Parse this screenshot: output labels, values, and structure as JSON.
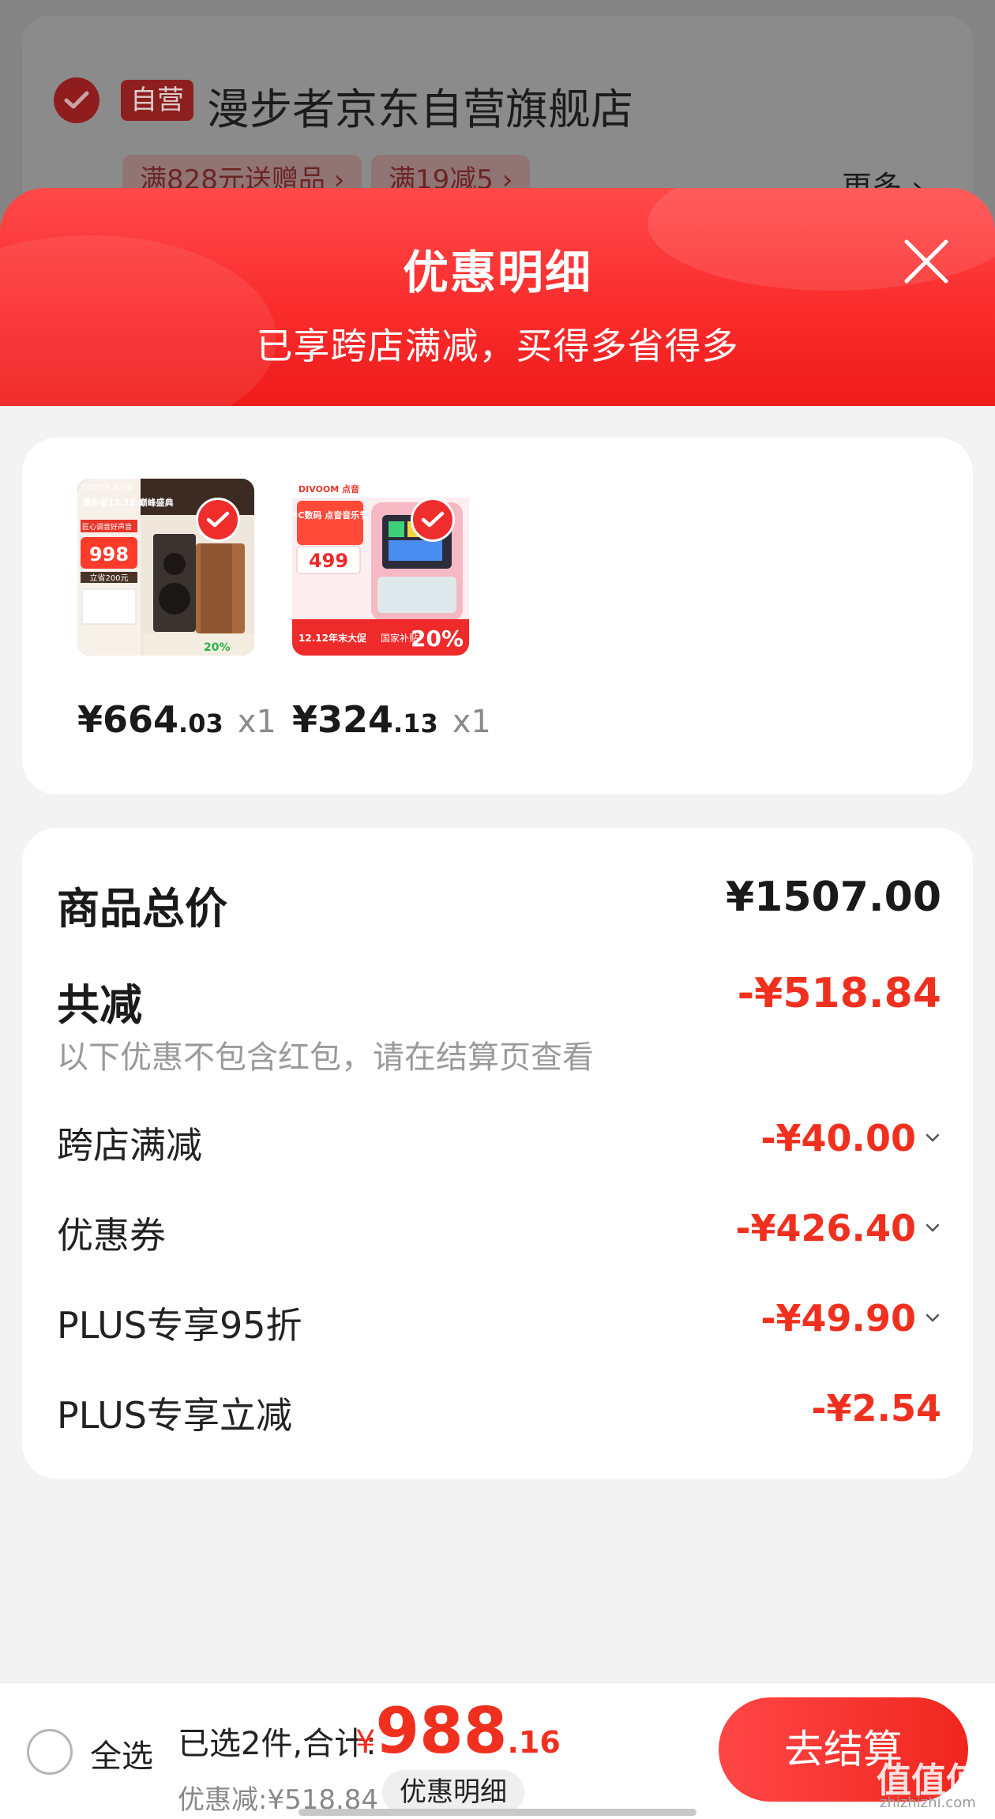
{
  "background_store": {
    "badge": "自营",
    "store_name": "漫步者京东自营旗舰店",
    "promo_chips": [
      "满828元送赠品 ›",
      "满19减5 ›"
    ],
    "more_label": "更多 ›"
  },
  "sheet": {
    "title": "优惠明细",
    "subtitle": "已享跨店满减，买得多省得多"
  },
  "products": [
    {
      "price_int": "¥664",
      "price_dec": ".03",
      "qty": "x1",
      "image": {
        "brand": "EDIFIER 漫步者",
        "headline": "漫步者12.12 巅峰盛典",
        "tag": "匠心调音好声音",
        "price": "998",
        "save": "立省200元",
        "subsidy": "20%"
      }
    },
    {
      "price_int": "¥324",
      "price_dec": ".13",
      "qty": "x1",
      "image": {
        "brand": "DIVOOM 点音",
        "headline": "3C数码 点音音乐节",
        "price": "499",
        "promo": "12.12年末大促",
        "subsidy_label": "国家补贴",
        "subsidy": "20%"
      }
    }
  ],
  "summary": {
    "total_label": "商品总价",
    "total_value": "¥1507.00",
    "discount_label": "共减",
    "discount_value": "-¥518.84",
    "discount_note": "以下优惠不包含红包，请在结算页查看",
    "items": [
      {
        "label": "跨店满减",
        "value": "-¥40.00",
        "expandable": true
      },
      {
        "label": "优惠券",
        "value": "-¥426.40",
        "expandable": true
      },
      {
        "label": "PLUS专享95折",
        "value": "-¥49.90",
        "expandable": true
      },
      {
        "label": "PLUS专享立减",
        "value": "-¥2.54",
        "expandable": false
      }
    ]
  },
  "bottom_bar": {
    "select_all": "全选",
    "selected_text": "已选2件,合计:",
    "currency": "¥",
    "total_int": "988",
    "total_dec": ".16",
    "saved_text": "优惠减:¥518.84",
    "detail_label": "优惠明细",
    "checkout_label": "去结算"
  },
  "watermark": {
    "text": "值值值",
    "sub": "zhizhizhi.com"
  },
  "colors": {
    "accent": "#f0301f",
    "header_red": "#fa2c2c"
  }
}
